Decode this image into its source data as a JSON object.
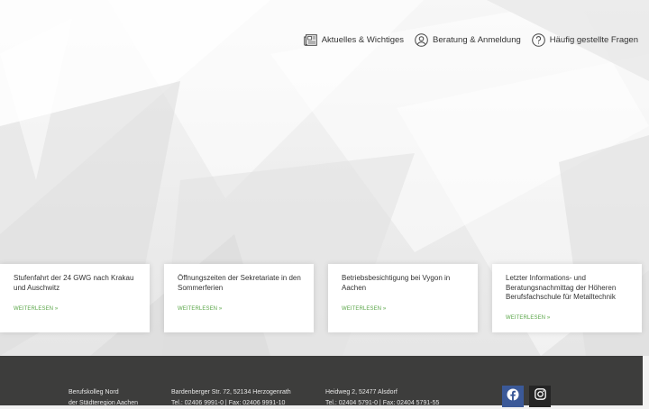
{
  "nav": {
    "items": [
      {
        "label": "Aktuelles & Wichtiges",
        "icon": "newspaper-icon"
      },
      {
        "label": "Beratung & Anmeldung",
        "icon": "user-circle-icon"
      },
      {
        "label": "Häufig gestellte Fragen",
        "icon": "question-circle-icon"
      }
    ]
  },
  "cards": [
    {
      "title": "Stufenfahrt der 24 GWG nach Krakau und Auschwitz",
      "link": "WEITERLESEN »"
    },
    {
      "title": "Öffnungszeiten der Sekretariate in den Sommerferien",
      "link": "WEITERLESEN »"
    },
    {
      "title": "Betriebsbesichtigung bei Vygon in Aachen",
      "link": "WEITERLESEN »"
    },
    {
      "title": "Letzter Informations- und Beratungsnachmittag der Höheren Berufsfachschule für Metalltechnik",
      "link": "WEITERLESEN »"
    }
  ],
  "footer": {
    "col1": [
      "Berufskolleg Nord",
      "der Städteregion Aachen"
    ],
    "col2": [
      "Bardenberger Str. 72, 52134 Herzogenrath",
      "Tel.: 02406 9991-0 | Fax: 02406 9991-10"
    ],
    "col3": [
      "Heidweg 2, 52477 Alsdorf",
      "Tel.: 02404 5791-0 | Fax: 02404 5791-55"
    ],
    "social": [
      {
        "icon": "facebook-icon",
        "color": "#3b5998"
      },
      {
        "icon": "instagram-icon",
        "color": "#252525"
      }
    ]
  },
  "colors": {
    "accent": "#5aa648",
    "footer_bg": "#3d3d3c"
  }
}
